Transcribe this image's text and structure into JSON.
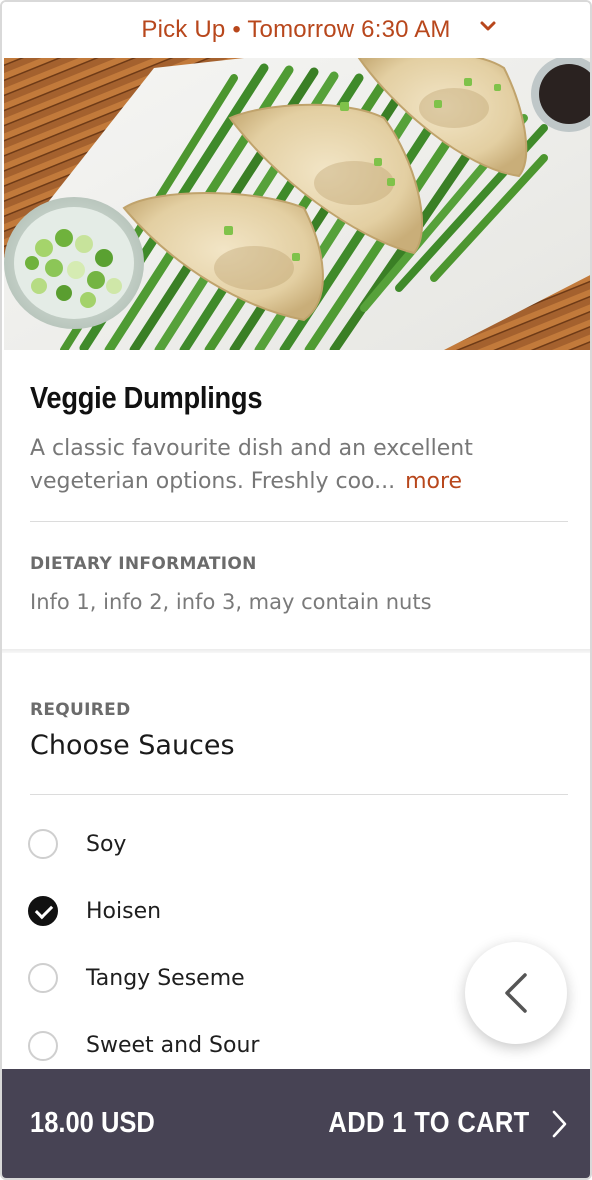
{
  "header": {
    "pickup_text": "Pick Up • Tomorrow 6:30 AM",
    "chevron_icon": "chevron-down-icon"
  },
  "item": {
    "image_alt": "dumplings with chives",
    "title": "Veggie Dumplings",
    "description": "A classic favourite dish and an excellent vegeterian options. Freshly coo...",
    "more_label": "more"
  },
  "dietary": {
    "label": "DIETARY INFORMATION",
    "text": "Info 1, info 2, info 3, may contain nuts"
  },
  "sauces": {
    "required_label": "REQUIRED",
    "title": "Choose Sauces",
    "options": [
      {
        "label": "Soy",
        "checked": false
      },
      {
        "label": "Hoisen",
        "checked": true
      },
      {
        "label": "Tangy Seseme",
        "checked": false
      },
      {
        "label": "Sweet and Sour",
        "checked": false
      }
    ]
  },
  "fab": {
    "icon": "chevron-left-icon"
  },
  "cart": {
    "price": "18.00 USD",
    "add_label": "ADD 1 TO CART",
    "icon": "chevron-right-icon"
  },
  "colors": {
    "accent": "#b8471c",
    "cart_bar": "#474354"
  }
}
